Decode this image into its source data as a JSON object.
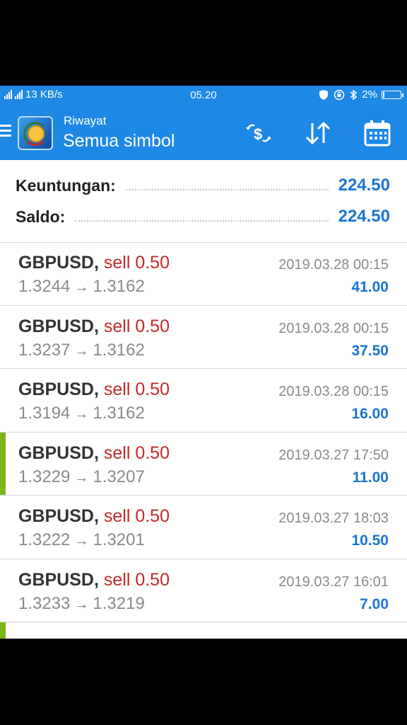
{
  "status_bar": {
    "network": "4G 3G",
    "speed": "13 KB/s",
    "time": "05.20",
    "battery": "2%"
  },
  "toolbar": {
    "subtitle": "Riwayat",
    "title": "Semua simbol",
    "icons": [
      "menu-icon",
      "app-logo",
      "exchange-icon",
      "sort-icon",
      "calendar-icon"
    ]
  },
  "summary": {
    "profit_label": "Keuntungan:",
    "profit_value": "224.50",
    "balance_label": "Saldo:",
    "balance_value": "224.50"
  },
  "trades": [
    {
      "symbol": "GBPUSD,",
      "side": "sell 0.50",
      "open": "1.3244",
      "close": "1.3162",
      "time": "2019.03.28 00:15",
      "profit": "41.00",
      "flag": false
    },
    {
      "symbol": "GBPUSD,",
      "side": "sell 0.50",
      "open": "1.3237",
      "close": "1.3162",
      "time": "2019.03.28 00:15",
      "profit": "37.50",
      "flag": false
    },
    {
      "symbol": "GBPUSD,",
      "side": "sell 0.50",
      "open": "1.3194",
      "close": "1.3162",
      "time": "2019.03.28 00:15",
      "profit": "16.00",
      "flag": false
    },
    {
      "symbol": "GBPUSD,",
      "side": "sell 0.50",
      "open": "1.3229",
      "close": "1.3207",
      "time": "2019.03.27 17:50",
      "profit": "11.00",
      "flag": true
    },
    {
      "symbol": "GBPUSD,",
      "side": "sell 0.50",
      "open": "1.3222",
      "close": "1.3201",
      "time": "2019.03.27 18:03",
      "profit": "10.50",
      "flag": false
    },
    {
      "symbol": "GBPUSD,",
      "side": "sell 0.50",
      "open": "1.3233",
      "close": "1.3219",
      "time": "2019.03.27 16:01",
      "profit": "7.00",
      "flag": false
    }
  ],
  "arrow_glyph": "→",
  "colors": {
    "toolbar": "#1e88e5",
    "profit": "#1976d2",
    "sell": "#c62828",
    "flag_marker": "#7cb518"
  }
}
